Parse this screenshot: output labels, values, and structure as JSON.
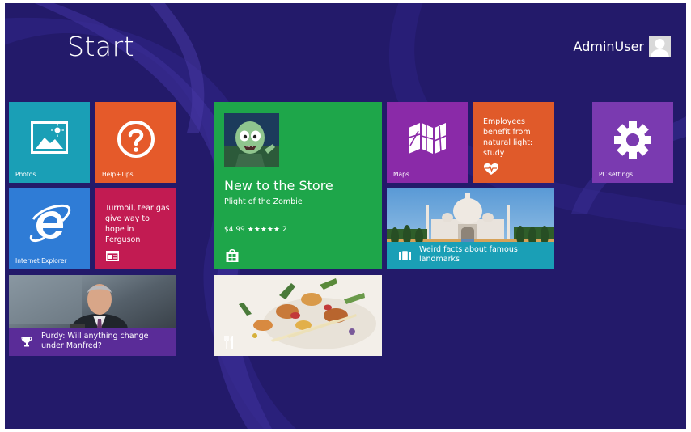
{
  "header": {
    "title": "Start",
    "user_name": "AdminUser"
  },
  "tiles": {
    "photos": {
      "label": "Photos",
      "color": "#1a9fb6",
      "icon": "photos-icon"
    },
    "help": {
      "label": "Help+Tips",
      "color": "#e55a2a",
      "icon": "question-icon"
    },
    "ie": {
      "label": "Internet Explorer",
      "color": "#2f7cd6",
      "icon": "internet-explorer-icon"
    },
    "news": {
      "headline": "Turmoil, tear gas give way to hope in Ferguson",
      "color": "#c21b52",
      "icon": "news-icon"
    },
    "sports": {
      "headline": "Purdy: Will anything change under Manfred?",
      "overlay_color": "#5a2c98",
      "icon": "trophy-icon"
    },
    "store": {
      "heading": "New to the Store",
      "app_name": "Plight of the Zombie",
      "price_rating": "$4.99 ★★★★★ 2",
      "color": "#1ea64a",
      "icon": "store-bag-icon"
    },
    "food": {
      "icon": "fork-knife-icon"
    },
    "maps": {
      "label": "Maps",
      "color": "#8a2aa8",
      "icon": "maps-icon"
    },
    "health": {
      "headline": "Employees benefit from natural light: study",
      "color": "#e05a2a",
      "icon": "heart-pulse-icon"
    },
    "travel": {
      "headline": "Weird facts about famous landmarks",
      "overlay_color": "#1a9fb6",
      "icon": "suitcase-icon"
    },
    "pc_settings": {
      "label": "PC settings",
      "color": "#7a3ab0",
      "icon": "gear-icon"
    }
  }
}
